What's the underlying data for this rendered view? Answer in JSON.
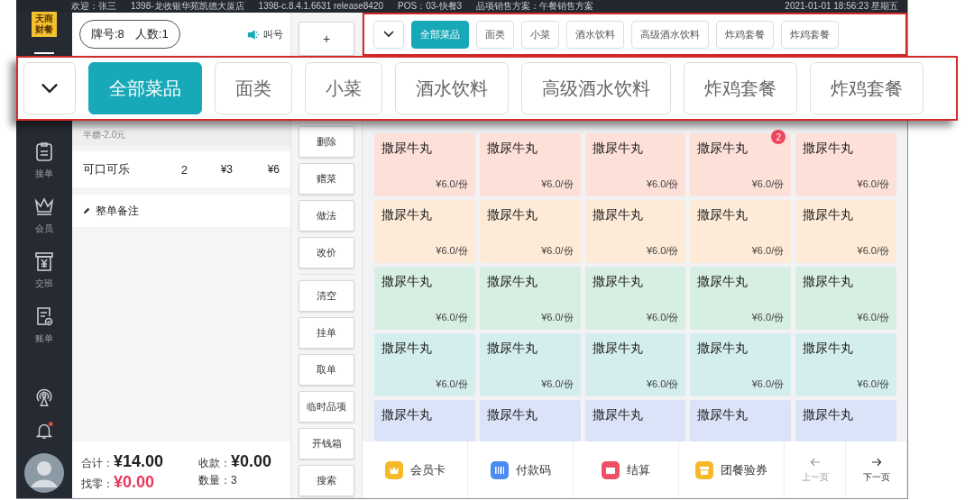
{
  "logo": {
    "line_1": "天商",
    "line_2": "财餐"
  },
  "status_bar": {
    "items": [
      "欢迎：张三",
      "1398-龙收银华苑凯德大厦店",
      "1398-c.8.4.1.6631 release8420",
      "POS：03-快餐3",
      "品项销售方案：午餐销售方案"
    ],
    "clock": "2021-01-01  18:56:23  星期五"
  },
  "sidebar": {
    "items": [
      {
        "kind": "orders",
        "label": "接单"
      },
      {
        "kind": "member",
        "label": "会员"
      },
      {
        "kind": "shift",
        "label": "交班"
      },
      {
        "kind": "bills",
        "label": "账单"
      }
    ],
    "bottom_icons": [
      {
        "kind": "broadcast"
      },
      {
        "kind": "bell",
        "alert": true
      },
      {
        "kind": "avatar"
      }
    ]
  },
  "order": {
    "table_number": "牌号:8",
    "guests": "人数:1",
    "call_button": "叫号",
    "items": [
      {
        "note": "半糖-2.0元"
      },
      {
        "name": "可口可乐",
        "qty": "2",
        "price": "¥3",
        "total": "¥6"
      }
    ],
    "remark": "整单备注",
    "totals": [
      {
        "label": "合计：",
        "value": "¥14.00",
        "kind": "plain"
      },
      {
        "label": "收款：",
        "value": "¥0.00",
        "kind": "plain"
      },
      {
        "label": "找零：",
        "value": "¥0.00",
        "kind": "alert"
      },
      {
        "label": "数量：",
        "value": "3",
        "kind": "small"
      }
    ]
  },
  "actions": [
    {
      "label": "+",
      "kind": "top"
    },
    {
      "label": "删除",
      "kind": "button"
    },
    {
      "label": "赠菜",
      "kind": "button"
    },
    {
      "label": "做法",
      "kind": "button"
    },
    {
      "label": "改价",
      "kind": "button"
    },
    {
      "kind": "divider"
    },
    {
      "label": "清空",
      "kind": "button"
    },
    {
      "label": "挂单",
      "kind": "button"
    },
    {
      "label": "取单",
      "kind": "button"
    },
    {
      "label": "临时品项",
      "kind": "button"
    },
    {
      "label": "开钱箱",
      "kind": "button"
    },
    {
      "label": "搜索",
      "kind": "button"
    }
  ],
  "categories": [
    {
      "label": "全部菜品",
      "selected": true
    },
    {
      "label": "面类",
      "selected": false
    },
    {
      "label": "小菜",
      "selected": false
    },
    {
      "label": "酒水饮料",
      "selected": false
    },
    {
      "label": "高级酒水饮料",
      "selected": false
    },
    {
      "label": "炸鸡套餐",
      "selected": false
    },
    {
      "label": "炸鸡套餐",
      "selected": false
    }
  ],
  "zoomed_categories": [
    {
      "label": "全部菜品",
      "selected": true
    },
    {
      "label": "面类",
      "selected": false
    },
    {
      "label": "小菜",
      "selected": false
    },
    {
      "label": "酒水饮料",
      "selected": false
    },
    {
      "label": "高级酒水饮料",
      "selected": false
    },
    {
      "label": "炸鸡套餐",
      "selected": false
    },
    {
      "label": "炸鸡套餐",
      "selected": false
    }
  ],
  "dish_rows": [
    {
      "color": "#fde1d9",
      "dishes": [
        {
          "name": "撒尿牛丸",
          "price": "¥6.0/份"
        },
        {
          "name": "撒尿牛丸",
          "price": "¥6.0/份"
        },
        {
          "name": "撒尿牛丸",
          "price": "¥6.0/份"
        },
        {
          "name": "撒尿牛丸",
          "price": "¥6.0/份",
          "badge": "2"
        },
        {
          "name": "撒尿牛丸",
          "price": "¥6.0/份"
        }
      ]
    },
    {
      "color": "#fdebd7",
      "dishes": [
        {
          "name": "撒尿牛丸",
          "price": "¥6.0/份"
        },
        {
          "name": "撒尿牛丸",
          "price": "¥6.0/份"
        },
        {
          "name": "撒尿牛丸",
          "price": "¥6.0/份"
        },
        {
          "name": "撒尿牛丸",
          "price": "¥6.0/份"
        },
        {
          "name": "撒尿牛丸",
          "price": "¥6.0/份"
        }
      ]
    },
    {
      "color": "#d7efe2",
      "dishes": [
        {
          "name": "撒尿牛丸",
          "price": "¥6.0/份"
        },
        {
          "name": "撒尿牛丸",
          "price": "¥6.0/份"
        },
        {
          "name": "撒尿牛丸",
          "price": "¥6.0/份"
        },
        {
          "name": "撒尿牛丸",
          "price": "¥6.0/份"
        },
        {
          "name": "撒尿牛丸",
          "price": "¥6.0/份"
        }
      ]
    },
    {
      "color": "#d4eeee",
      "dishes": [
        {
          "name": "撒尿牛丸",
          "price": "¥6.0/份"
        },
        {
          "name": "撒尿牛丸",
          "price": "¥6.0/份"
        },
        {
          "name": "撒尿牛丸",
          "price": "¥6.0/份"
        },
        {
          "name": "撒尿牛丸",
          "price": "¥6.0/份"
        },
        {
          "name": "撒尿牛丸",
          "price": "¥6.0/份"
        }
      ]
    },
    {
      "color": "#dbe3f8",
      "dishes": [
        {
          "name": "撒尿牛丸"
        },
        {
          "name": "撒尿牛丸"
        },
        {
          "name": "撒尿牛丸"
        },
        {
          "name": "撒尿牛丸"
        },
        {
          "name": "撒尿牛丸"
        }
      ]
    }
  ],
  "bottom_bar": {
    "actions": [
      {
        "kind": "member",
        "label": "会员卡"
      },
      {
        "kind": "paycode",
        "label": "付款码"
      },
      {
        "kind": "checkout",
        "label": "结算"
      },
      {
        "kind": "coupon",
        "label": "团餐验券"
      }
    ],
    "pages": [
      {
        "kind": "prev",
        "label": "上一页",
        "disabled": true
      },
      {
        "kind": "next",
        "label": "下一页",
        "disabled": false
      }
    ]
  }
}
